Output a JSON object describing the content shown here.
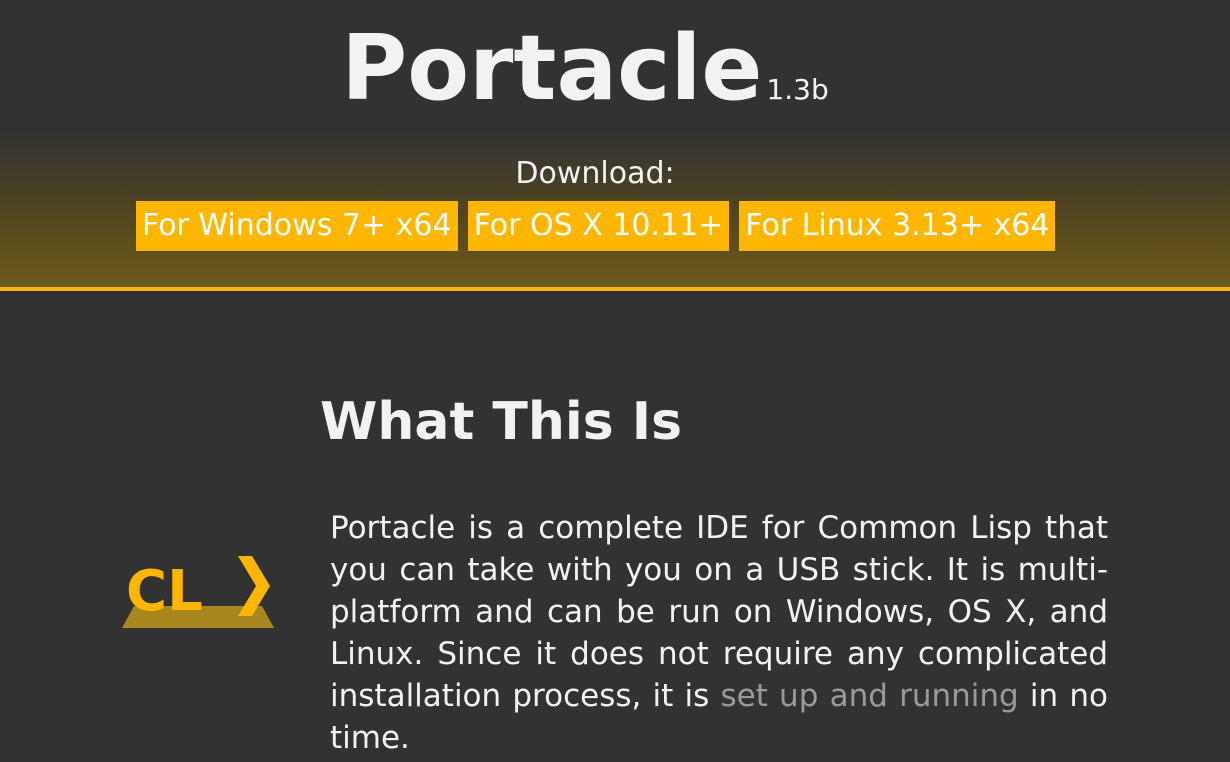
{
  "header": {
    "title": "Portacle",
    "version": "1.3b",
    "download_label": "Download:",
    "download_buttons": [
      {
        "label": "For Windows 7+ x64"
      },
      {
        "label": "For OS X 10.11+"
      },
      {
        "label": "For Linux 3.13+ x64"
      }
    ],
    "accent_color": "#ffb600"
  },
  "section": {
    "title": "What This Is",
    "logo_text": "CL",
    "logo_icon": "cl-prompt-logo",
    "description_before": "Portacle is a complete IDE for Common Lisp that you can take with you on a USB stick. It is multi-platform and can be run on Windows, OS X, and Linux. Since it does not require any complicated installation process, it is ",
    "description_link": "set up and running",
    "description_after": " in no time."
  }
}
